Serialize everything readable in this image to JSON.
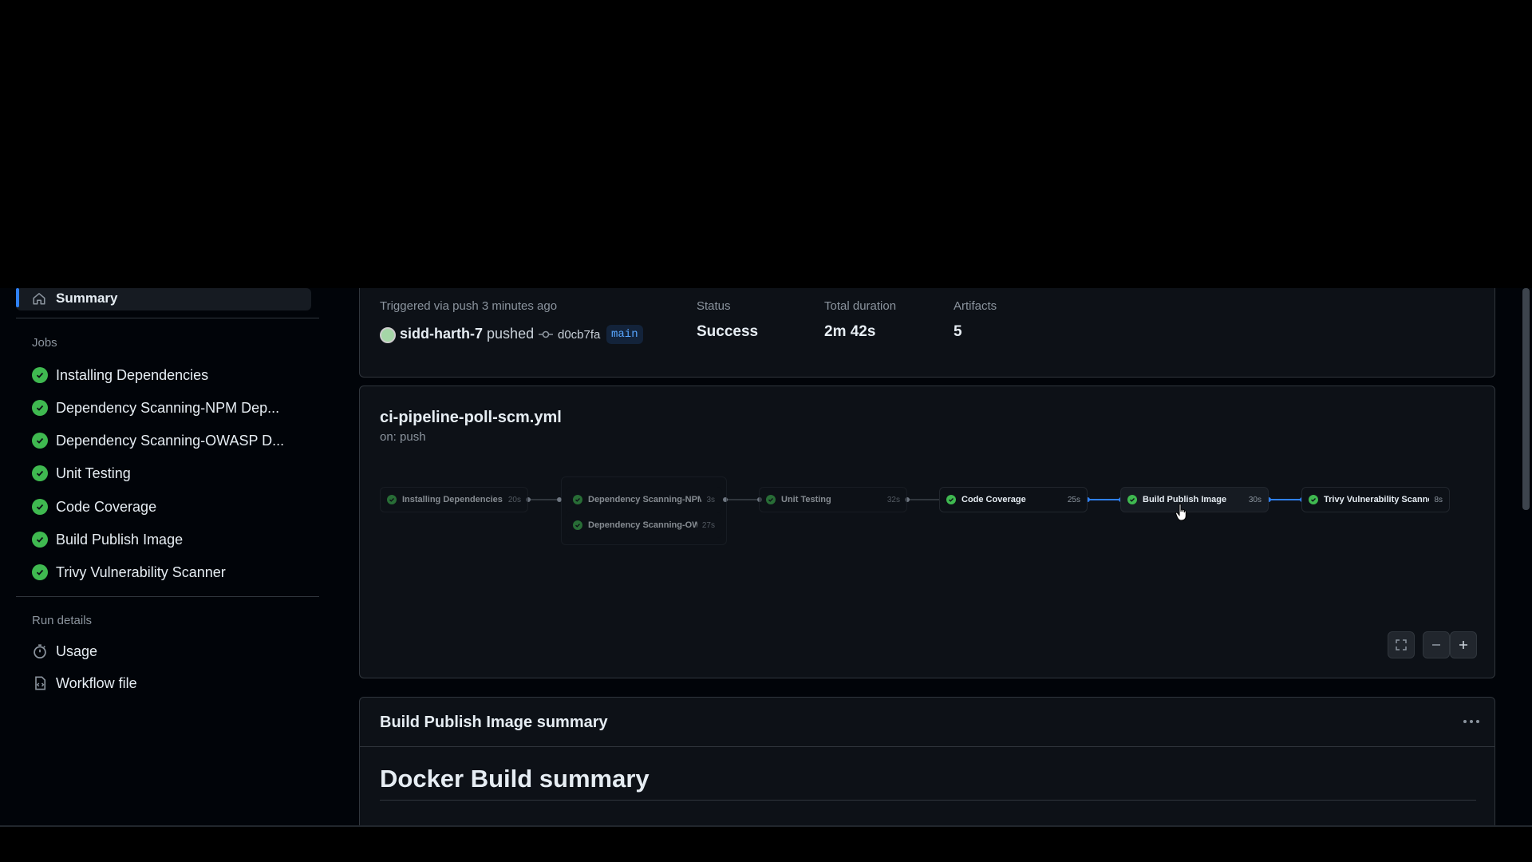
{
  "sidebar": {
    "summary_label": "Summary",
    "jobs_title": "Jobs",
    "jobs": [
      {
        "label": "Installing Dependencies"
      },
      {
        "label": "Dependency Scanning-NPM Dep..."
      },
      {
        "label": "Dependency Scanning-OWASP D..."
      },
      {
        "label": "Unit Testing"
      },
      {
        "label": "Code Coverage"
      },
      {
        "label": "Build Publish Image"
      },
      {
        "label": "Trivy Vulnerability Scanner"
      }
    ],
    "run_details_title": "Run details",
    "run_details": [
      {
        "label": "Usage",
        "icon": "stopwatch-icon"
      },
      {
        "label": "Workflow file",
        "icon": "file-code-icon"
      }
    ]
  },
  "run_info": {
    "trigger_text": "Triggered via push 3 minutes ago",
    "actor": "sidd-harth-7",
    "action": "pushed",
    "commit": "d0cb7fa",
    "branch": "main",
    "status_label": "Status",
    "status_value": "Success",
    "duration_label": "Total duration",
    "duration_value": "2m 42s",
    "artifacts_label": "Artifacts",
    "artifacts_value": "5"
  },
  "workflow": {
    "file": "ci-pipeline-poll-scm.yml",
    "trigger": "on: push",
    "nodes": [
      {
        "label": "Installing Dependencies",
        "duration": "20s"
      },
      {
        "label": "Dependency Scanning-NPM ...",
        "duration": "3s"
      },
      {
        "label": "Dependency Scanning-OW...",
        "duration": "27s"
      },
      {
        "label": "Unit Testing",
        "duration": "32s"
      },
      {
        "label": "Code Coverage",
        "duration": "25s"
      },
      {
        "label": "Build Publish Image",
        "duration": "30s"
      },
      {
        "label": "Trivy Vulnerability Scanner",
        "duration": "8s"
      }
    ]
  },
  "summary": {
    "title": "Build Publish Image summary",
    "heading": "Docker Build summary"
  },
  "colors": {
    "success": "#3fb950",
    "accent": "#2f81f7",
    "background": "#010409"
  }
}
